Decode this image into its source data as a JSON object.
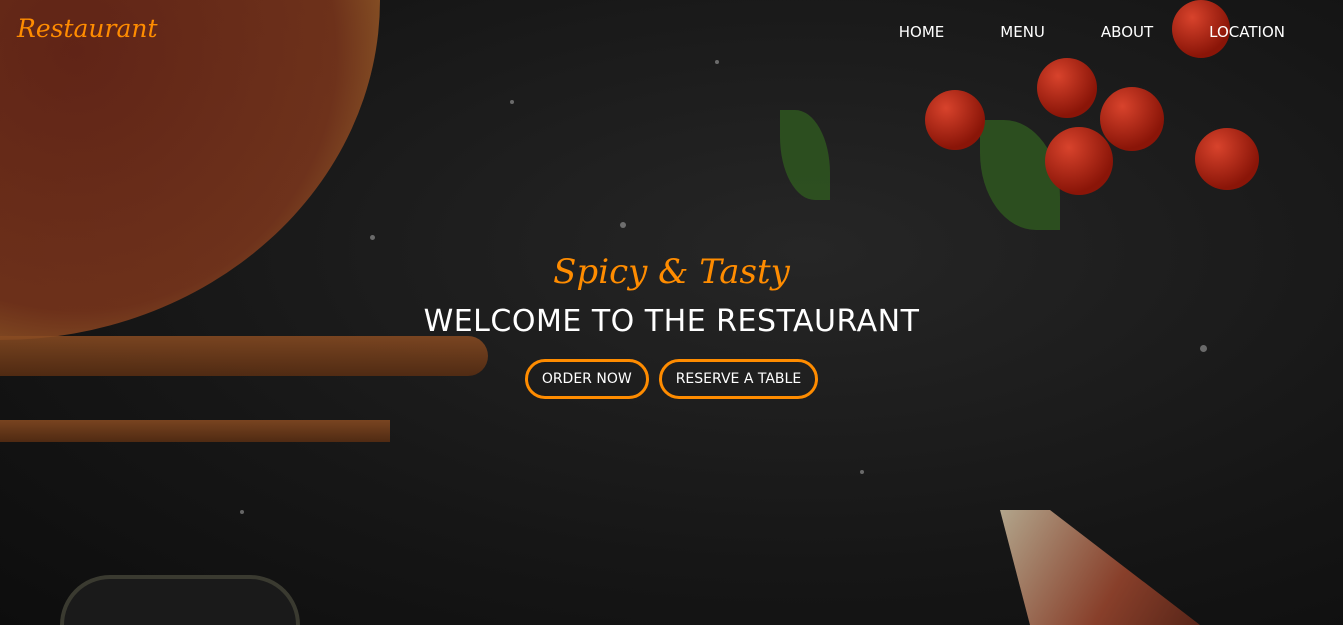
{
  "nav": {
    "brand": "Restaurant",
    "items": [
      "HOME",
      "MENU",
      "ABOUT",
      "LOCATION"
    ]
  },
  "hero": {
    "tagline": "Spicy & Tasty",
    "title": "WELCOME TO THE RESTAURANT",
    "buttons": {
      "order": "ORDER NOW",
      "reserve": "RESERVE A TABLE"
    }
  },
  "colors": {
    "accent": "#ff8c00"
  }
}
